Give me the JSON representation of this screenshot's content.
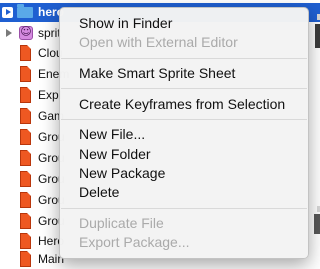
{
  "tree": {
    "selected_item": "hero",
    "sprite_item": "sprit",
    "files": [
      "Clou",
      "Enem",
      "Expl",
      "Gam",
      "Grou",
      "Grou",
      "Grou",
      "Grou",
      "Grou",
      "Hero",
      "Main"
    ]
  },
  "menu": {
    "items": [
      {
        "label": "Show in Finder",
        "enabled": true
      },
      {
        "label": "Open with External Editor",
        "enabled": false
      },
      {
        "label": "Make Smart Sprite Sheet",
        "enabled": true
      },
      {
        "label": "Create Keyframes from Selection",
        "enabled": true
      },
      {
        "label": "New File...",
        "enabled": true
      },
      {
        "label": "New Folder",
        "enabled": true
      },
      {
        "label": "New Package",
        "enabled": true
      },
      {
        "label": "Delete",
        "enabled": true
      },
      {
        "label": "Duplicate File",
        "enabled": false
      },
      {
        "label": "Export Package...",
        "enabled": false
      }
    ]
  }
}
